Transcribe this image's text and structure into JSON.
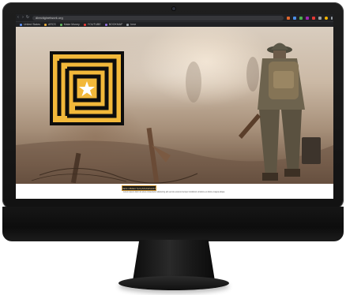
{
  "browser": {
    "nav": {
      "back": "‹",
      "forward": "›",
      "reload": "↻"
    },
    "url": "directiginetwork.org",
    "extensions": [
      {
        "icon": "extension-icon",
        "color": "#e0662e"
      },
      {
        "icon": "extension-icon",
        "color": "#4a8fe7"
      },
      {
        "icon": "extension-icon",
        "color": "#4caf50"
      },
      {
        "icon": "extension-icon",
        "color": "#9c27b0"
      },
      {
        "icon": "extension-icon",
        "color": "#e53935"
      },
      {
        "icon": "extension-icon",
        "color": "#9aa0a6"
      },
      {
        "icon": "profile-icon",
        "color": "#f5b400"
      },
      {
        "icon": "menu-icon",
        "color": "#9aa0a6"
      }
    ],
    "bookmarks": [
      {
        "label": "United States",
        "color": "#5b8def"
      },
      {
        "label": "ARCS",
        "color": "#e7a93a"
      },
      {
        "label": "Make Money",
        "color": "#5fb35f"
      },
      {
        "label": "YOUTUBE",
        "color": "#e53935"
      },
      {
        "label": "BOOKMAF",
        "color": "#8e6dd8"
      },
      {
        "label": "Irme",
        "color": "#9aa0a6"
      }
    ]
  },
  "hero": {
    "logo": {
      "icon": "maze-star-logo",
      "color": "#f2b83a",
      "background": "#0d0d0d"
    },
    "image": "soldier-walking-battlefield-photo"
  },
  "footer": {
    "credit": "DESI OBJECT(21)/MAKESHIFT",
    "caption": "Lorem ipsum dolor sit amet consectetur adipiscing elit sed do eiusmod tempor incididunt ut labore et dolore magna aliqua"
  }
}
